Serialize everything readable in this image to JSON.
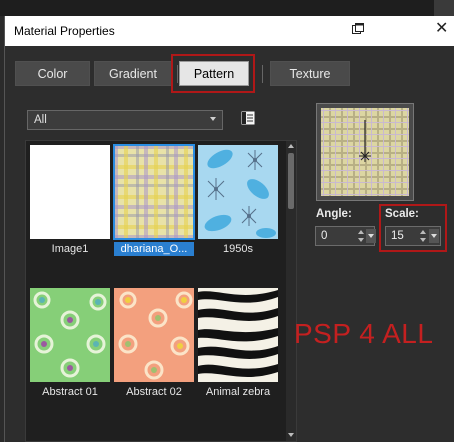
{
  "window": {
    "title": "Material Properties"
  },
  "tabs": [
    {
      "label": "Color",
      "active": false
    },
    {
      "label": "Gradient",
      "active": false
    },
    {
      "label": "Pattern",
      "active": true
    },
    {
      "label": "Texture",
      "active": false
    }
  ],
  "category_dropdown": {
    "value": "All"
  },
  "patterns": [
    {
      "name": "Image1",
      "selected": false
    },
    {
      "name": "dhariana_O...",
      "selected": true
    },
    {
      "name": "1950s",
      "selected": false
    },
    {
      "name": "Abstract 01",
      "selected": false
    },
    {
      "name": "Abstract 02",
      "selected": false
    },
    {
      "name": "Animal zebra",
      "selected": false
    }
  ],
  "angle": {
    "label": "Angle:",
    "value": "0"
  },
  "scale": {
    "label": "Scale:",
    "value": "15"
  },
  "watermark": "PSP 4 ALL",
  "colors": {
    "highlight": "#b01818",
    "selection": "#2a7fd0"
  }
}
